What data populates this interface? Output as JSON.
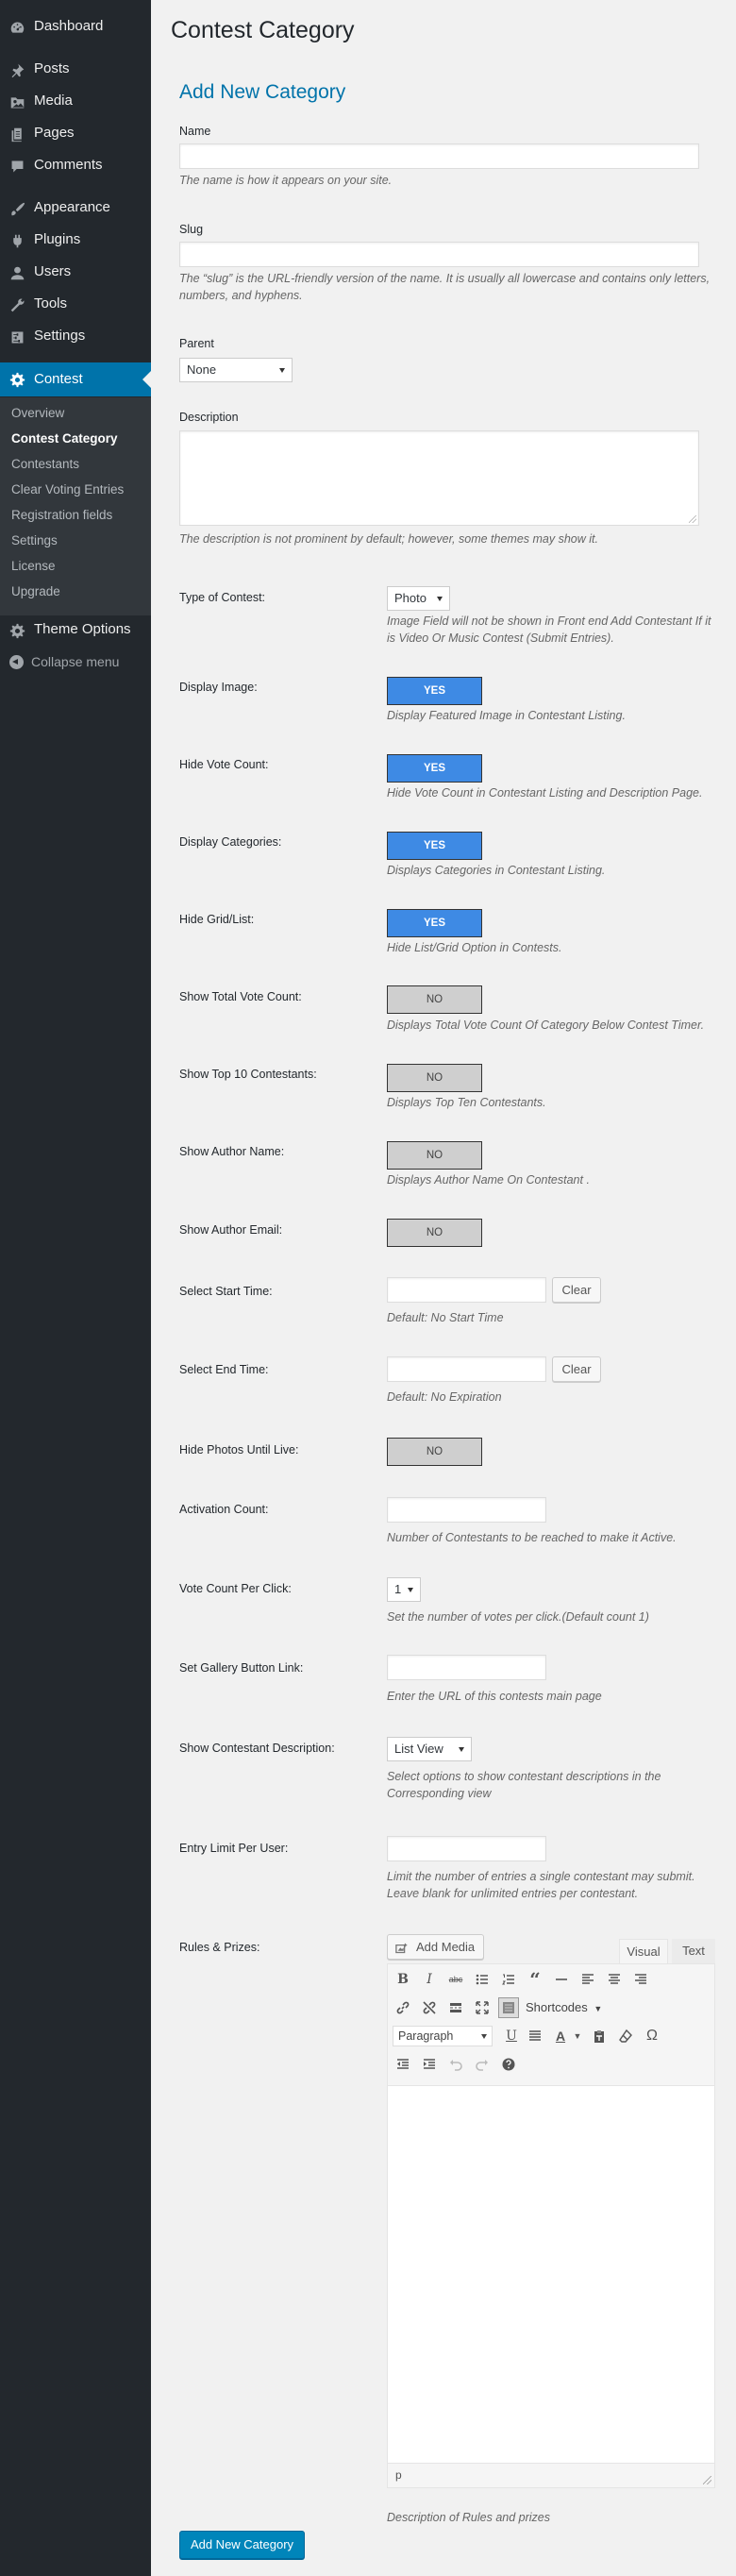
{
  "sidebar": {
    "dashboard": "Dashboard",
    "posts": "Posts",
    "media": "Media",
    "pages": "Pages",
    "comments": "Comments",
    "appearance": "Appearance",
    "plugins": "Plugins",
    "users": "Users",
    "tools": "Tools",
    "settings": "Settings",
    "contest": "Contest",
    "submenu": [
      "Overview",
      "Contest Category",
      "Contestants",
      "Clear Voting Entries",
      "Registration fields",
      "Settings",
      "License",
      "Upgrade"
    ],
    "theme_options": "Theme Options",
    "collapse": "Collapse menu"
  },
  "page": {
    "title": "Contest Category",
    "form_title": "Add New Category"
  },
  "form": {
    "name_label": "Name",
    "name_desc": "The name is how it appears on your site.",
    "slug_label": "Slug",
    "slug_desc": "The “slug” is the URL-friendly version of the name. It is usually all lowercase and contains only letters, numbers, and hyphens.",
    "parent_label": "Parent",
    "parent_value": "None",
    "description_label": "Description",
    "description_desc": "The description is not prominent by default; however, some themes may show it.",
    "type_label": "Type of Contest:",
    "type_value": "Photo",
    "type_desc": "Image Field will not be shown in Front end Add Contestant If it is Video Or Music Contest (Submit Entries).",
    "display_image_label": "Display Image:",
    "display_image_value": "YES",
    "display_image_desc": "Display Featured Image in Contestant Listing.",
    "hide_vote_label": "Hide Vote Count:",
    "hide_vote_value": "YES",
    "hide_vote_desc": "Hide Vote Count in Contestant Listing and Description Page.",
    "display_categories_label": "Display Categories:",
    "display_categories_value": "YES",
    "display_categories_desc": "Displays Categories in Contestant Listing.",
    "hide_grid_label": "Hide Grid/List:",
    "hide_grid_value": "YES",
    "hide_grid_desc": "Hide List/Grid Option in Contests.",
    "total_vote_label": "Show Total Vote Count:",
    "total_vote_value": "NO",
    "total_vote_desc": "Displays Total Vote Count Of Category Below Contest Timer.",
    "top10_label": "Show Top 10 Contestants:",
    "top10_value": "NO",
    "top10_desc": "Displays Top Ten Contestants.",
    "author_name_label": "Show Author Name:",
    "author_name_value": "NO",
    "author_name_desc": "Displays Author Name On Contestant .",
    "author_email_label": "Show Author Email:",
    "author_email_value": "NO",
    "start_time_label": "Select Start Time:",
    "start_clear": "Clear",
    "start_desc": "Default: No Start Time",
    "end_time_label": "Select End Time:",
    "end_clear": "Clear",
    "end_desc": "Default: No Expiration",
    "hide_photos_label": "Hide Photos Until Live:",
    "hide_photos_value": "NO",
    "activation_label": "Activation Count:",
    "activation_desc": "Number of Contestants to be reached to make it Active.",
    "vote_per_click_label": "Vote Count Per Click:",
    "vote_per_click_value": "1",
    "vote_per_click_desc": "Set the number of votes per click.(Default count 1)",
    "gallery_label": "Set Gallery Button Link:",
    "gallery_desc": "Enter the URL of this contests main page",
    "show_desc_label": "Show Contestant Description:",
    "show_desc_value": "List View",
    "show_desc_desc": "Select options to show contestant descriptions in the Corresponding view",
    "entry_limit_label": "Entry Limit Per User:",
    "entry_limit_desc": "Limit the number of entries a single contestant may submit. Leave blank for unlimited entries per contestant.",
    "rules_label": "Rules & Prizes:",
    "rules_desc": "Description of Rules and prizes",
    "submit": "Add New Category"
  },
  "editor": {
    "add_media": "Add Media",
    "tab_visual": "Visual",
    "tab_text": "Text",
    "shortcodes": "Shortcodes",
    "format": "Paragraph",
    "status_path": "p"
  },
  "colors": {
    "admin_bar": "#23282d",
    "accent": "#0073aa",
    "toggle_on": "#3e8ae4",
    "toggle_off": "#cfcfcf",
    "primary_button": "#0085ba"
  }
}
